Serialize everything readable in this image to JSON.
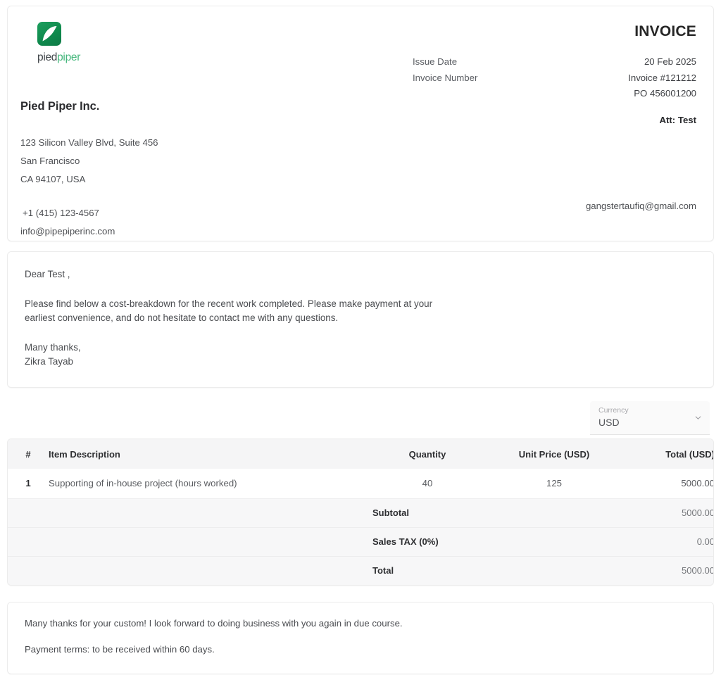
{
  "brand": {
    "logo_icon": "piedpiper-leaf-logo",
    "word_first": "pied",
    "word_second": "piper",
    "accent_color": "#45b77c",
    "logo_color": "#0f8a4d"
  },
  "header": {
    "title": "INVOICE",
    "issue_date_label": "Issue Date",
    "issue_date_value": "20 Feb 2025",
    "invoice_number_label": "Invoice Number",
    "invoice_number_value": "Invoice #121212",
    "po_value": "PO 456001200",
    "attention": "Att: Test",
    "company_name": "Pied Piper Inc.",
    "address_line1": "123 Silicon Valley Blvd, Suite 456",
    "address_line2": "San Francisco",
    "address_line3": "CA 94107, USA",
    "phone": "+1 (415) 123-4567",
    "email": "info@pipepiperinc.com",
    "client_email": "gangstertaufiq@gmail.com"
  },
  "message": {
    "greeting": "Dear Test ,",
    "body": "Please find below a cost-breakdown for the recent work completed. Please make payment at your earliest convenience, and do not hesitate to contact me with any questions.",
    "signoff": "Many thanks,",
    "signature": "Zikra Tayab"
  },
  "currency": {
    "label": "Currency",
    "value": "USD",
    "chevron_icon": "chevron-down-icon",
    "options": [
      "USD"
    ]
  },
  "table": {
    "headers": {
      "number": "#",
      "description": "Item Description",
      "quantity": "Quantity",
      "unit_price": "Unit Price  (USD)",
      "total": "Total  (USD)"
    },
    "rows": [
      {
        "number": "1",
        "description": "Supporting of in-house project (hours worked)",
        "quantity": "40",
        "unit_price": "125",
        "total": "5000.00"
      }
    ],
    "totals": [
      {
        "label": "Subtotal",
        "value": "5000.00"
      },
      {
        "label": "Sales TAX (0%)",
        "value": "0.00"
      },
      {
        "label": "Total",
        "value": "5000.00"
      }
    ]
  },
  "footer": {
    "thanks": "Many thanks for your custom! I look forward to doing business with you again in due course.",
    "terms": "Payment terms: to be received within 60 days."
  }
}
